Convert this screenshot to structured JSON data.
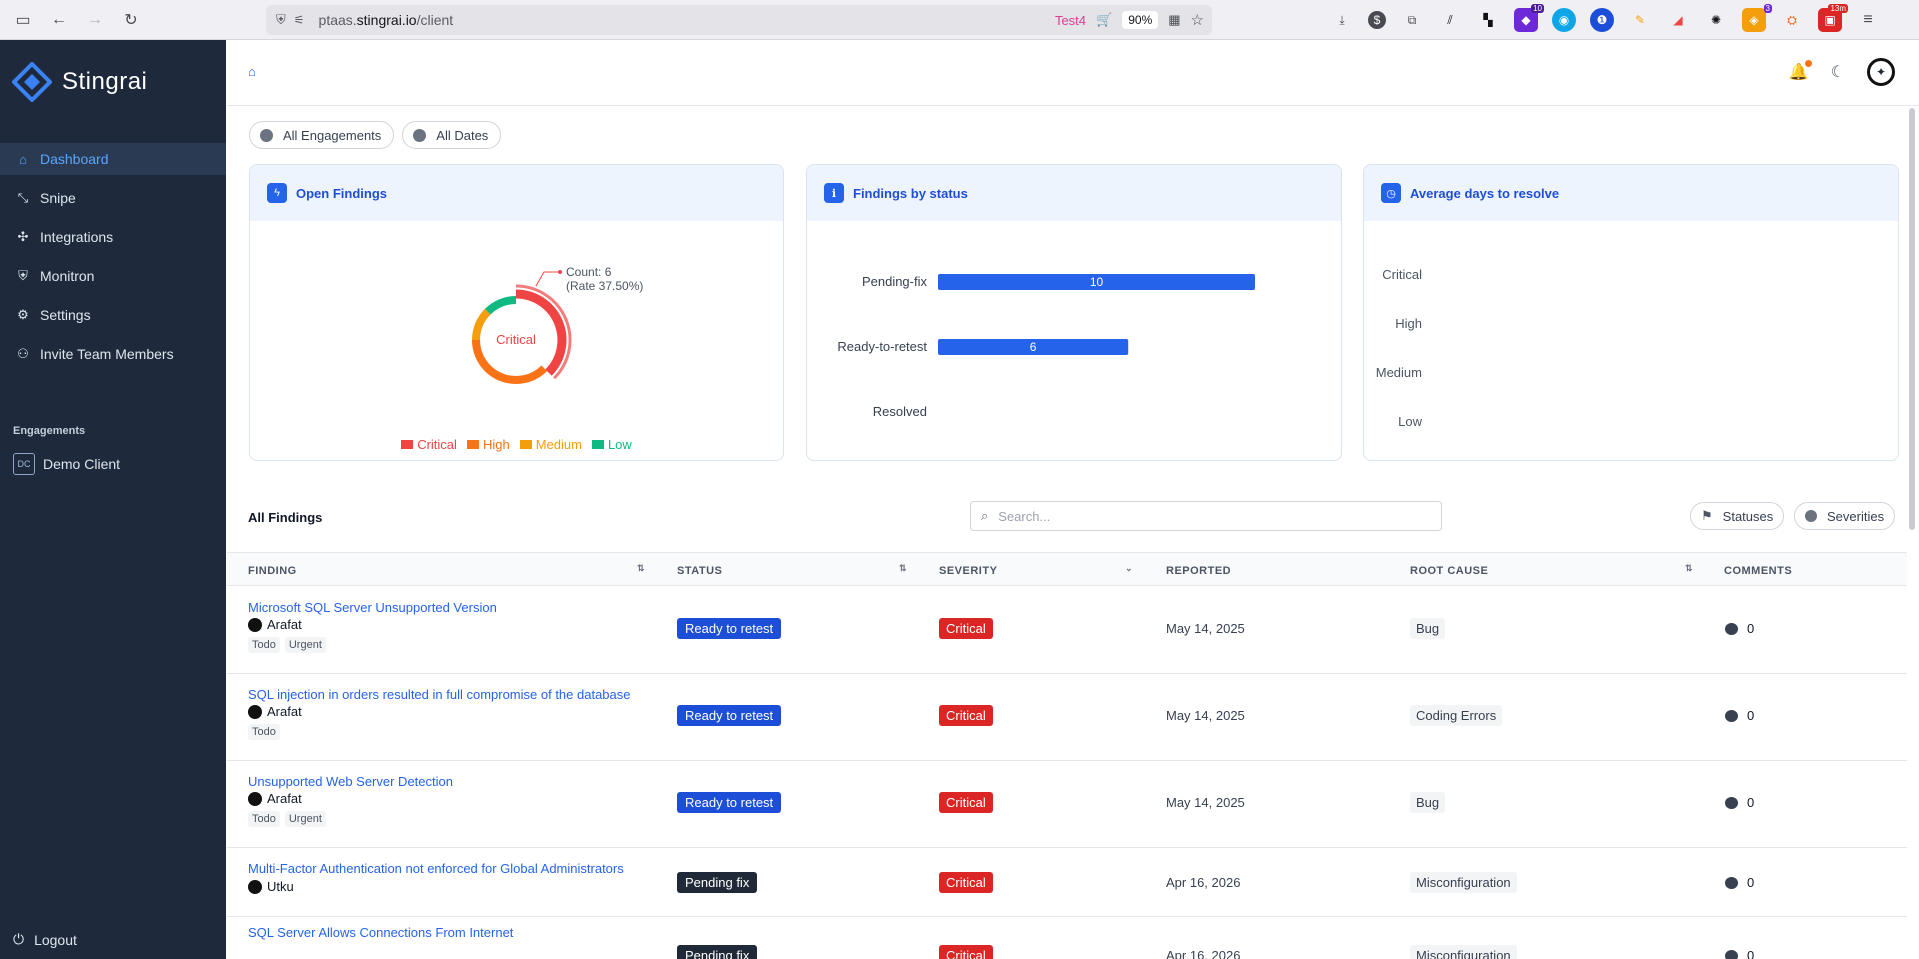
{
  "browser": {
    "url_prefix": "ptaas.",
    "url_domain": "stingrai.io",
    "url_path": "/client",
    "container_tab": "Test4",
    "zoom": "90%",
    "ext_badges": [
      "10",
      "3",
      "13m"
    ]
  },
  "sidebar": {
    "brand": "Stingrai",
    "items": [
      {
        "label": "Dashboard",
        "icon": "home-icon",
        "active": true
      },
      {
        "label": "Snipe",
        "icon": "snipe-icon"
      },
      {
        "label": "Integrations",
        "icon": "integrations-icon"
      },
      {
        "label": "Monitron",
        "icon": "shield-icon"
      },
      {
        "label": "Settings",
        "icon": "gear-icon"
      },
      {
        "label": "Invite Team Members",
        "icon": "users-icon"
      }
    ],
    "engagements_title": "Engagements",
    "engagement": {
      "initials": "DC",
      "label": "Demo Client"
    },
    "logout": "Logout"
  },
  "filters": {
    "engagements": "All Engagements",
    "dates": "All Dates"
  },
  "cards": {
    "open_findings": {
      "title": "Open Findings",
      "center_label": "Critical",
      "tooltip_count": "Count: 6",
      "tooltip_rate": "(Rate 37.50%)",
      "legend": [
        {
          "label": "Critical",
          "color": "#ef4444"
        },
        {
          "label": "High",
          "color": "#f97316"
        },
        {
          "label": "Medium",
          "color": "#f59e0b"
        },
        {
          "label": "Low",
          "color": "#10b981"
        }
      ]
    },
    "by_status": {
      "title": "Findings by status",
      "labels": [
        "Pending-fix",
        "Ready-to-retest",
        "Resolved"
      ],
      "values": [
        10,
        6,
        0
      ],
      "bar_color": "#2563eb"
    },
    "avg_days": {
      "title": "Average days to resolve",
      "labels": [
        "Critical",
        "High",
        "Medium",
        "Low"
      ]
    }
  },
  "chart_data": [
    {
      "type": "pie",
      "title": "Open Findings",
      "categories": [
        "Critical",
        "High",
        "Medium",
        "Low"
      ],
      "values": [
        6,
        6,
        2,
        2
      ]
    },
    {
      "type": "bar",
      "title": "Findings by status",
      "categories": [
        "Pending-fix",
        "Ready-to-retest",
        "Resolved"
      ],
      "values": [
        10,
        6,
        0
      ]
    }
  ],
  "table": {
    "title": "All Findings",
    "search_placeholder": "Search...",
    "statuses_btn": "Statuses",
    "severities_btn": "Severities",
    "headers": [
      "FINDING",
      "STATUS",
      "SEVERITY",
      "REPORTED",
      "ROOT CAUSE",
      "COMMENTS"
    ],
    "rows": [
      {
        "title": "Microsoft SQL Server Unsupported Version",
        "assignee": "Arafat",
        "tags": [
          "Todo",
          "Urgent"
        ],
        "status": "Ready to retest",
        "severity": "Critical",
        "reported": "May 14, 2025",
        "root_cause": "Bug",
        "comments": "0"
      },
      {
        "title": "SQL injection in orders resulted in full compromise of the database",
        "assignee": "Arafat",
        "tags": [
          "Todo"
        ],
        "status": "Ready to retest",
        "severity": "Critical",
        "reported": "May 14, 2025",
        "root_cause": "Coding Errors",
        "comments": "0"
      },
      {
        "title": "Unsupported Web Server Detection",
        "assignee": "Arafat",
        "tags": [
          "Todo",
          "Urgent"
        ],
        "status": "Ready to retest",
        "severity": "Critical",
        "reported": "May 14, 2025",
        "root_cause": "Bug",
        "comments": "0"
      },
      {
        "title": "Multi-Factor Authentication not enforced for Global Administrators",
        "assignee": "Utku",
        "tags": [],
        "status": "Pending fix",
        "severity": "Critical",
        "reported": "Apr 16, 2026",
        "root_cause": "Misconfiguration",
        "comments": "0"
      },
      {
        "title": "SQL Server Allows Connections From Internet",
        "assignee": "",
        "tags": [],
        "status": "Pending fix",
        "severity": "Critical",
        "reported": "Apr 16, 2026",
        "root_cause": "Misconfiguration",
        "comments": "0"
      }
    ]
  }
}
